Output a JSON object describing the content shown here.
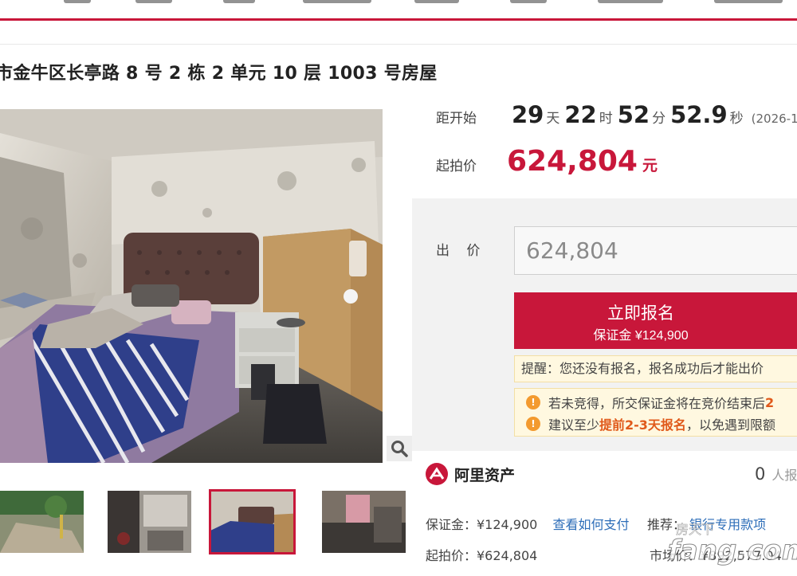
{
  "page": {
    "title": "市金牛区长亭路 8 号 2 栋 2 单元 10 层 1003 号房屋"
  },
  "auction": {
    "countdown_label": "距开始",
    "days": "29",
    "days_unit": "天",
    "hours": "22",
    "hours_unit": "时",
    "minutes": "52",
    "minutes_unit": "分",
    "seconds": "52.9",
    "seconds_unit": "秒",
    "start_date": "(2026-1",
    "start_price_label": "起拍价",
    "start_price": "624,804",
    "start_price_unit": "元"
  },
  "bid": {
    "label": "出 价",
    "value": "624,804",
    "signup_label": "立即报名",
    "deposit_line": "保证金 ¥124,900",
    "reminder": "提醒：您还没有报名，报名成功后才能出价",
    "notice_1_prefix": "若未竞得，所交保证金将在竞价结束后",
    "notice_1_suffix": "2",
    "notice_2_prefix": "建议至少",
    "notice_2_highlight": "提前2-3天报名",
    "notice_2_suffix": "，以免遇到限额"
  },
  "platform": {
    "name": "阿里资产",
    "count": "0",
    "count_unit": "人报"
  },
  "info": {
    "deposit": "保证金：¥124,900",
    "how_to_pay": "查看如何支付",
    "recommend_label": "推荐：",
    "bank_account": "银行专用款项",
    "start_price": "起拍价：¥624,804",
    "market_price": "市场价：¥892,577.04"
  },
  "watermark": {
    "brand": "fang.com",
    "sub": "房天下"
  },
  "colors": {
    "accent": "#c8173a",
    "warning": "#f39a2e",
    "highlight": "#e0591a",
    "link": "#2c6db8"
  },
  "icons": {
    "zoom": "magnifier-icon",
    "warning": "exclamation-circle-icon",
    "logo": "alibaba-asset-logo"
  }
}
